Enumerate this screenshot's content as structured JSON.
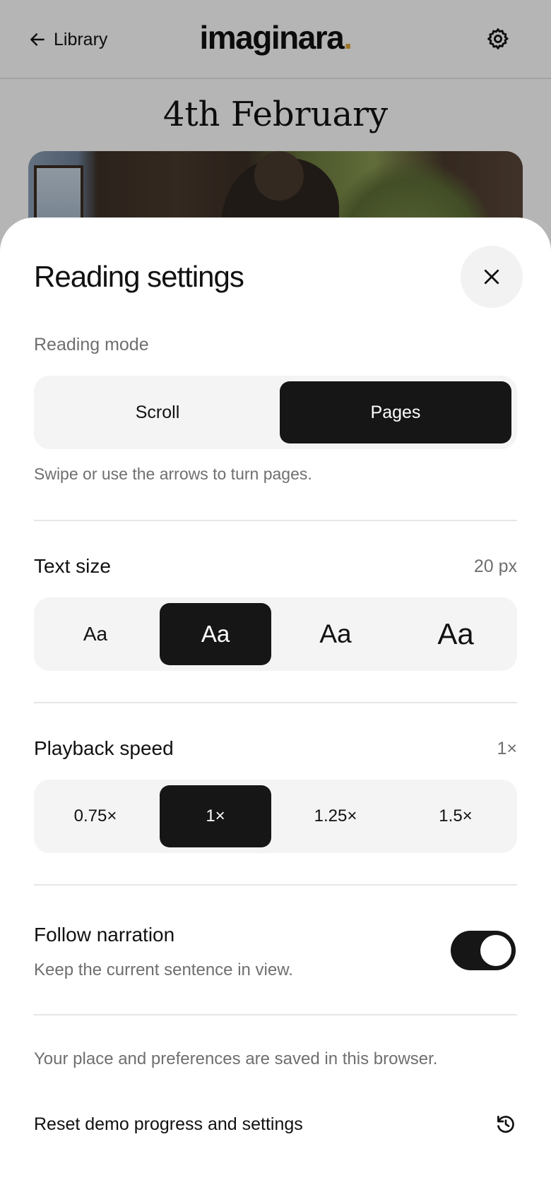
{
  "header": {
    "back_label": "Library",
    "logo_text": "imaginara",
    "logo_dot": ".",
    "accent_color": "#e0a53c"
  },
  "chapter": {
    "title": "4th February"
  },
  "sheet": {
    "title": "Reading settings",
    "reading_mode": {
      "label": "Reading mode",
      "options": [
        "Scroll",
        "Pages"
      ],
      "selected": "Pages",
      "hint": "Swipe or use the arrows to turn pages."
    },
    "text_size": {
      "label": "Text size",
      "value": "20 px",
      "options": [
        "Aa",
        "Aa",
        "Aa",
        "Aa"
      ],
      "selected_index": 1
    },
    "playback_speed": {
      "label": "Playback speed",
      "value": "1×",
      "options": [
        "0.75×",
        "1×",
        "1.25×",
        "1.5×"
      ],
      "selected_index": 1
    },
    "follow_narration": {
      "label": "Follow narration",
      "description": "Keep the current sentence in view.",
      "enabled": true
    },
    "storage_note": "Your place and preferences are saved in this browser.",
    "reset_label": "Reset demo progress and settings"
  },
  "icons": {
    "back": "arrow-left-icon",
    "settings": "gear-icon",
    "close": "close-icon",
    "reset": "reset-icon"
  }
}
